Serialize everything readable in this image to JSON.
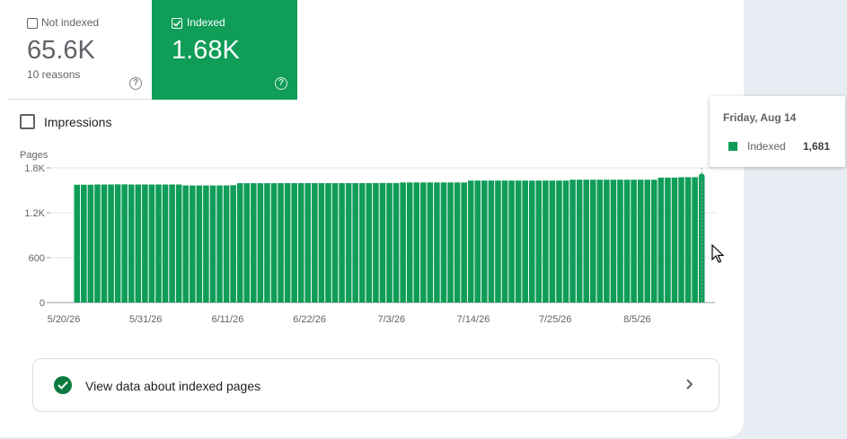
{
  "tiles": {
    "not_indexed": {
      "title": "Not indexed",
      "value": "65.6K",
      "sub": "10 reasons",
      "checked": false
    },
    "indexed": {
      "title": "Indexed",
      "value": "1.68K",
      "checked": true,
      "color": "#0f9d58"
    }
  },
  "impressions_label": "Impressions",
  "chart_data": {
    "type": "bar",
    "ylabel": "Pages",
    "ylim": [
      0,
      1800
    ],
    "yticks": [
      "0",
      "600",
      "1.2K",
      "1.8K"
    ],
    "x_tick_labels": [
      "5/20/26",
      "5/31/26",
      "6/11/26",
      "6/22/26",
      "7/3/26",
      "7/14/26",
      "7/25/26",
      "8/5/26"
    ],
    "series": [
      {
        "name": "Indexed",
        "color": "#0f9d58",
        "values": [
          1575,
          1575,
          1575,
          1578,
          1578,
          1578,
          1580,
          1580,
          1578,
          1578,
          1578,
          1578,
          1578,
          1578,
          1578,
          1578,
          1565,
          1565,
          1565,
          1565,
          1565,
          1565,
          1565,
          1568,
          1595,
          1595,
          1595,
          1595,
          1595,
          1595,
          1596,
          1596,
          1596,
          1596,
          1596,
          1596,
          1596,
          1596,
          1596,
          1596,
          1596,
          1596,
          1596,
          1596,
          1598,
          1598,
          1598,
          1598,
          1605,
          1605,
          1605,
          1605,
          1605,
          1605,
          1605,
          1605,
          1605,
          1605,
          1630,
          1630,
          1630,
          1630,
          1630,
          1630,
          1630,
          1630,
          1630,
          1630,
          1630,
          1630,
          1630,
          1630,
          1630,
          1642,
          1642,
          1642,
          1642,
          1642,
          1642,
          1642,
          1642,
          1642,
          1642,
          1642,
          1642,
          1642,
          1670,
          1670,
          1670,
          1675,
          1675,
          1675,
          1681
        ]
      }
    ]
  },
  "tooltip": {
    "date": "Friday, Aug 14",
    "series": "Indexed",
    "value": "1,681"
  },
  "view_data_label": "View data about indexed pages"
}
